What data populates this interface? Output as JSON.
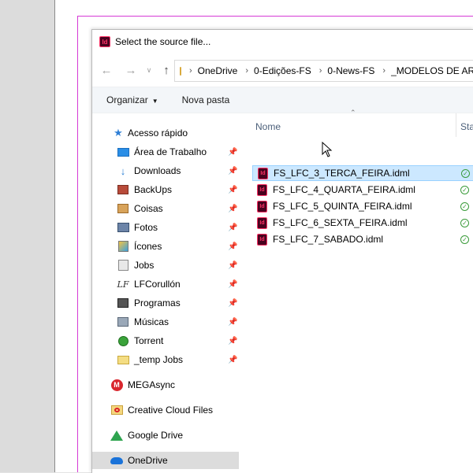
{
  "dialog": {
    "title": "Select the source file...",
    "app_icon_text": "Id"
  },
  "address": {
    "breadcrumbs": [
      "OneDrive",
      "0-Edições-FS",
      "0-News-FS",
      "_MODELOS DE AR"
    ]
  },
  "toolbar": {
    "organize_label": "Organizar",
    "new_folder_label": "Nova pasta"
  },
  "nav": {
    "quick_access_label": "Acesso rápido",
    "items": [
      {
        "label": "Área de Trabalho",
        "icon": "desktop-icon",
        "pinned": true
      },
      {
        "label": "Downloads",
        "icon": "download-icon",
        "pinned": true
      },
      {
        "label": "BackUps",
        "icon": "backup-icon",
        "pinned": true
      },
      {
        "label": "Coisas",
        "icon": "box-icon",
        "pinned": true
      },
      {
        "label": "Fotos",
        "icon": "photos-icon",
        "pinned": true
      },
      {
        "label": "Ícones",
        "icon": "icons-folder-icon",
        "pinned": true
      },
      {
        "label": "Jobs",
        "icon": "jobs-icon",
        "pinned": true
      },
      {
        "label": "LFCorullón",
        "icon": "signature-icon",
        "pinned": true
      },
      {
        "label": "Programas",
        "icon": "programs-icon",
        "pinned": true
      },
      {
        "label": "Músicas",
        "icon": "music-icon",
        "pinned": true
      },
      {
        "label": "Torrent",
        "icon": "torrent-icon",
        "pinned": true
      },
      {
        "label": "_temp Jobs",
        "icon": "temp-folder-icon",
        "pinned": true
      }
    ],
    "roots": [
      {
        "label": "MEGAsync",
        "icon": "mega-icon"
      },
      {
        "label": "Creative Cloud Files",
        "icon": "creative-cloud-icon"
      },
      {
        "label": "Google Drive",
        "icon": "google-drive-icon"
      },
      {
        "label": "OneDrive",
        "icon": "onedrive-icon",
        "selected": true
      }
    ]
  },
  "files": {
    "header_name": "Nome",
    "header_status": "Sta",
    "rows": [
      {
        "name": "FS_LFC_3_TERCA_FEIRA.idml",
        "selected": true
      },
      {
        "name": "FS_LFC_4_QUARTA_FEIRA.idml",
        "selected": false
      },
      {
        "name": "FS_LFC_5_QUINTA_FEIRA.idml",
        "selected": false
      },
      {
        "name": "FS_LFC_6_SEXTA_FEIRA.idml",
        "selected": false
      },
      {
        "name": "FS_LFC_7_SABADO.idml",
        "selected": false
      }
    ],
    "file_icon_text": "Id"
  },
  "colors": {
    "selection": "#cce8ff",
    "guide": "#d63ad6",
    "indesign": "#ff3366"
  }
}
